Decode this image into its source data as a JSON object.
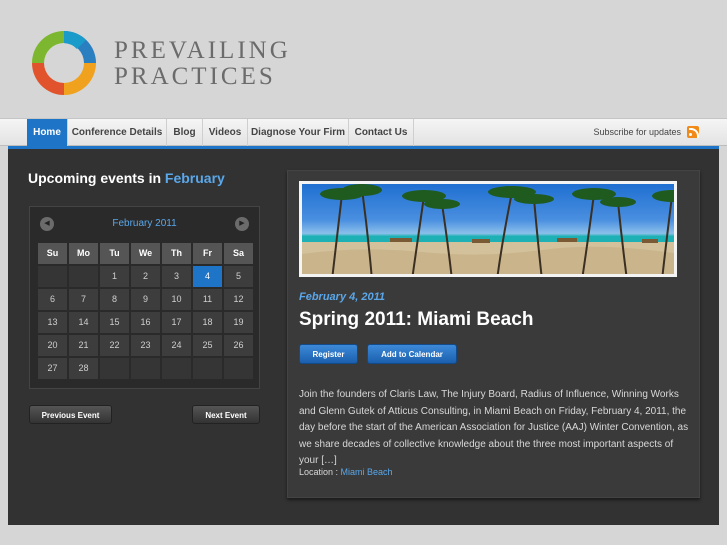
{
  "brand": {
    "line1": "PREVAILING",
    "line2": "PRACTICES"
  },
  "nav": {
    "items": [
      {
        "label": "Home",
        "active": true
      },
      {
        "label": "Conference Details"
      },
      {
        "label": "Blog"
      },
      {
        "label": "Videos"
      },
      {
        "label": "Diagnose Your Firm"
      },
      {
        "label": "Contact Us"
      }
    ],
    "subscribe": "Subscribe for updates",
    "rss_icon": "rss-icon"
  },
  "events": {
    "heading_prefix": "Upcoming events in",
    "heading_month": "February"
  },
  "calendar": {
    "title": "February 2011",
    "weekdays": [
      "Su",
      "Mo",
      "Tu",
      "We",
      "Th",
      "Fr",
      "Sa"
    ],
    "days": [
      "1",
      "2",
      "3",
      "4",
      "5",
      "6",
      "7",
      "8",
      "9",
      "10",
      "11",
      "12",
      "13",
      "14",
      "15",
      "16",
      "17",
      "18",
      "19",
      "20",
      "21",
      "22",
      "23",
      "24",
      "25",
      "26",
      "27",
      "28"
    ],
    "selected_day": "4",
    "prev_icon": "chevron-left-icon",
    "next_icon": "chevron-right-icon"
  },
  "buttons": {
    "prev_event": "Previous Event",
    "next_event": "Next Event"
  },
  "event": {
    "date": "February 4, 2011",
    "title": "Spring 2011: Miami Beach",
    "register": "Register",
    "add_calendar": "Add to Calendar",
    "description": "Join the founders of Claris Law, The Injury Board, Radius of Influence, Winning Works and Glenn Gutek of Atticus Consulting, in Miami Beach on Friday, February 4, 2011, the day before the start of the American Association for Justice (AAJ) Winter Convention, as we share decades of collective knowledge about the three most important aspects of your […]",
    "location_label": "Location :",
    "location_value": "Miami Beach"
  },
  "colors": {
    "accent": "#1e74c6",
    "link": "#5aa7ea",
    "panel": "#323232"
  }
}
